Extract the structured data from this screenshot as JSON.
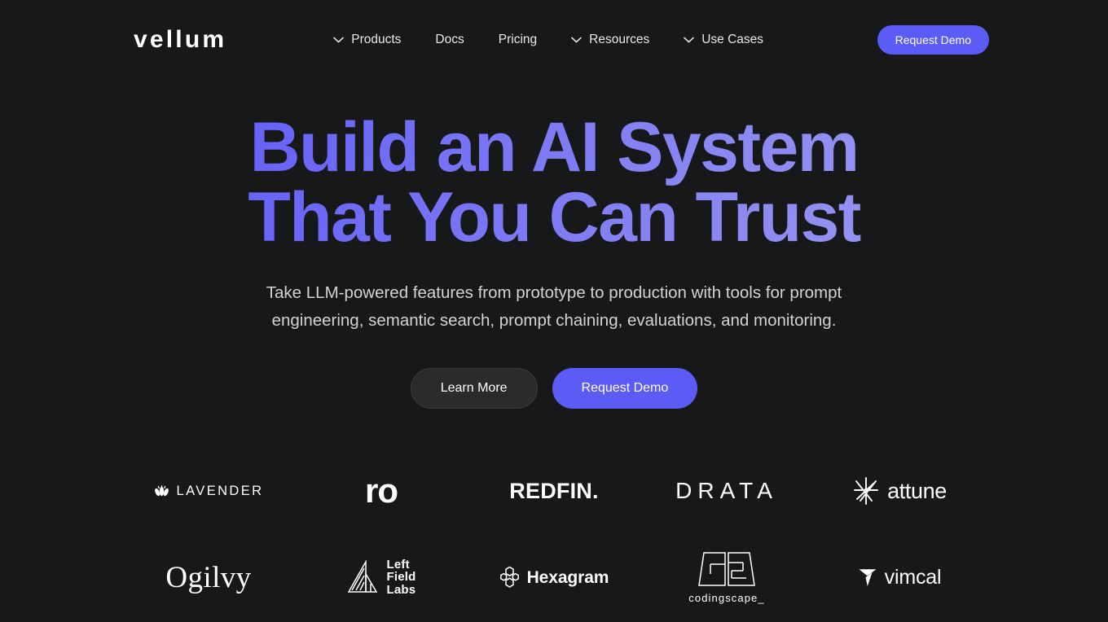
{
  "brand": {
    "wordmark": "vellum"
  },
  "colors": {
    "background": "#171819",
    "accent": "#5b5bf5",
    "headline_gradient_start": "#5654f6",
    "headline_gradient_end": "#a3a1f1",
    "body_text": "#d2d3d5"
  },
  "nav": {
    "items": [
      {
        "label": "Products",
        "has_chevron": true,
        "icon": "chevron-down-icon"
      },
      {
        "label": "Docs",
        "has_chevron": false,
        "icon": ""
      },
      {
        "label": "Pricing",
        "has_chevron": false,
        "icon": ""
      },
      {
        "label": "Resources",
        "has_chevron": true,
        "icon": "chevron-down-icon"
      },
      {
        "label": "Use Cases",
        "has_chevron": true,
        "icon": "chevron-down-icon"
      }
    ],
    "cta_label": "Request Demo"
  },
  "hero": {
    "headline_line1": "Build an AI System",
    "headline_line2": "That You Can Trust",
    "subtitle": "Take LLM-powered features from prototype to production with tools for prompt engineering, semantic search, prompt chaining, evaluations, and monitoring.",
    "secondary_cta": "Learn More",
    "primary_cta": "Request Demo"
  },
  "logo_wall": {
    "row1": [
      {
        "name": "lavender",
        "text": "LAVENDER",
        "icon": "lavender-flower-icon"
      },
      {
        "name": "ro",
        "text": "ro",
        "icon": ""
      },
      {
        "name": "redfin",
        "text": "REDFIN.",
        "icon": ""
      },
      {
        "name": "drata",
        "text": "DRATA",
        "icon": ""
      },
      {
        "name": "attune",
        "text": "attune",
        "icon": "attune-starburst-icon"
      }
    ],
    "row2": [
      {
        "name": "ogilvy",
        "text": "Ogilvy",
        "icon": ""
      },
      {
        "name": "left-field-labs",
        "text": "Left\nField\nLabs",
        "line1": "Left",
        "line2": "Field",
        "line3": "Labs",
        "icon": "left-field-labs-triangle-icon"
      },
      {
        "name": "hexagram",
        "text": "Hexagram",
        "icon": "hexagram-honeycomb-icon"
      },
      {
        "name": "codingscape",
        "text": "codingscape_",
        "icon": "codingscape-cs-monogram-icon"
      },
      {
        "name": "vimcal",
        "text": "vimcal",
        "icon": "vimcal-plane-icon"
      }
    ]
  }
}
